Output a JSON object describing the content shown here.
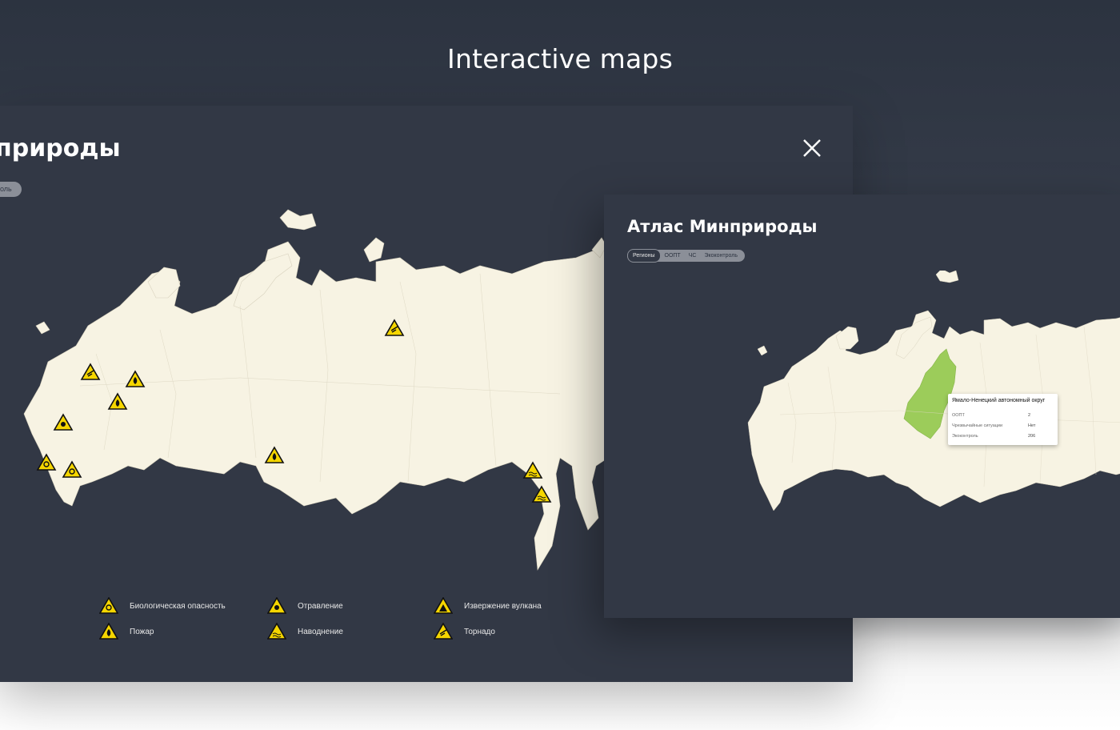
{
  "page": {
    "heading": "Interactive maps"
  },
  "back_panel": {
    "title": "природы",
    "pill_label": "оль",
    "legend": [
      {
        "icon": "biohazard-icon",
        "label": "Биологическая опасность"
      },
      {
        "icon": "poison-icon",
        "label": "Отравление"
      },
      {
        "icon": "volcano-icon",
        "label": "Извержение вулкана"
      },
      {
        "icon": "fire-icon",
        "label": "Пожар"
      },
      {
        "icon": "flood-icon",
        "label": "Наводнение"
      },
      {
        "icon": "tornado-icon",
        "label": "Торнадо"
      }
    ]
  },
  "front_panel": {
    "title": "Атлас Минприроды",
    "tabs": [
      {
        "label": "Регионы",
        "active": true
      },
      {
        "label": "ООПТ",
        "active": false
      },
      {
        "label": "ЧС",
        "active": false
      },
      {
        "label": "Экоконтроль",
        "active": false
      }
    ],
    "tooltip": {
      "region": "Ямало-Ненецкий автономный округ",
      "rows": [
        {
          "label": "ООПТ",
          "value": "2"
        },
        {
          "label": "Чрезвычайные ситуации",
          "value": "Нет"
        },
        {
          "label": "Экоконтроль",
          "value": "206"
        }
      ]
    }
  },
  "colors": {
    "background": "#323845",
    "land": "#f7f3e3",
    "highlight_region": "#9ccc5a",
    "warning_yellow": "#f5d600"
  }
}
